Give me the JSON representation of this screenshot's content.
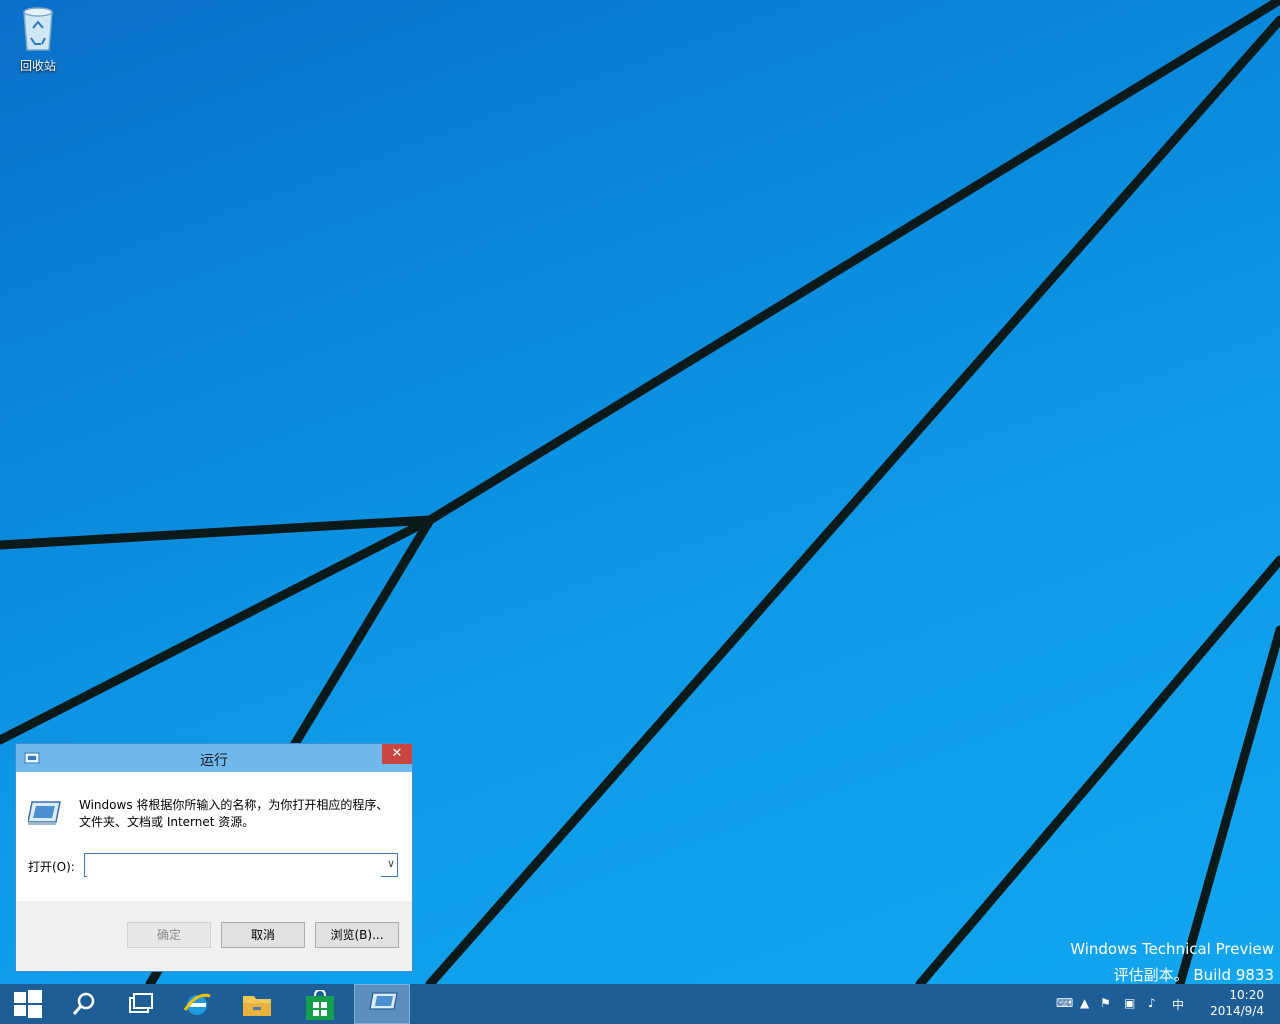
{
  "desktop": {
    "recycle_bin_label": "回收站",
    "watermark_line1": "Windows Technical Preview",
    "watermark_line2": "评估副本。 Build 9833"
  },
  "run_dialog": {
    "title": "运行",
    "close_glyph": "✕",
    "description_line1": "Windows 将根据你所输入的名称，为你打开相应的程序、",
    "description_line2": "文件夹、文档或 Internet 资源。",
    "open_label": "打开(O):",
    "open_value": "",
    "ok_label": "确定",
    "cancel_label": "取消",
    "browse_label": "浏览(B)..."
  },
  "taskbar": {
    "items": [
      "start-icon",
      "search-icon",
      "task-view-icon",
      "internet-explorer-icon",
      "file-explorer-icon",
      "store-icon",
      "run-icon"
    ],
    "tray": {
      "show_hidden": "▲",
      "ime": "中",
      "time": "10:20",
      "date": "2014/9/4"
    }
  },
  "colors": {
    "accent": "#1e5e96",
    "titlebar": "#6fb9ee",
    "close": "#c7463f"
  }
}
